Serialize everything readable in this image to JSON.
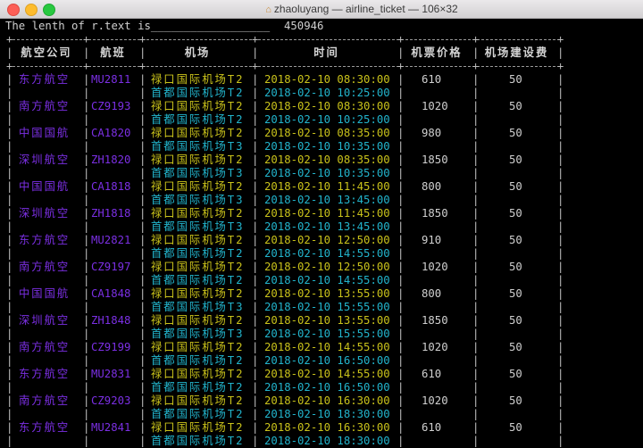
{
  "window": {
    "title": "zhaoluyang — airline_ticket — 106×32"
  },
  "colors": {
    "airline": "#7b2fe3",
    "departure": "#c9c21b",
    "arrival": "#22b4cc",
    "text": "#cfcfcf"
  },
  "output": {
    "length_label": "The lenth of r.text is__________________",
    "length_value": "450946"
  },
  "table": {
    "headers": [
      "航空公司",
      "航班",
      "机场",
      "时间",
      "机票价格",
      "机场建设费"
    ],
    "rows": [
      {
        "airline": "东方航空",
        "flight": "MU2811",
        "dep_airport": "禄口国际机场T2",
        "dep_time": "2018-02-10 08:30:00",
        "arr_airport": "首都国际机场T2",
        "arr_time": "2018-02-10 10:25:00",
        "price": "610",
        "fee": "50"
      },
      {
        "airline": "南方航空",
        "flight": "CZ9193",
        "dep_airport": "禄口国际机场T2",
        "dep_time": "2018-02-10 08:30:00",
        "arr_airport": "首都国际机场T2",
        "arr_time": "2018-02-10 10:25:00",
        "price": "1020",
        "fee": "50"
      },
      {
        "airline": "中国国航",
        "flight": "CA1820",
        "dep_airport": "禄口国际机场T2",
        "dep_time": "2018-02-10 08:35:00",
        "arr_airport": "首都国际机场T3",
        "arr_time": "2018-02-10 10:35:00",
        "price": "980",
        "fee": "50"
      },
      {
        "airline": "深圳航空",
        "flight": "ZH1820",
        "dep_airport": "禄口国际机场T2",
        "dep_time": "2018-02-10 08:35:00",
        "arr_airport": "首都国际机场T3",
        "arr_time": "2018-02-10 10:35:00",
        "price": "1850",
        "fee": "50"
      },
      {
        "airline": "中国国航",
        "flight": "CA1818",
        "dep_airport": "禄口国际机场T2",
        "dep_time": "2018-02-10 11:45:00",
        "arr_airport": "首都国际机场T3",
        "arr_time": "2018-02-10 13:45:00",
        "price": "800",
        "fee": "50"
      },
      {
        "airline": "深圳航空",
        "flight": "ZH1818",
        "dep_airport": "禄口国际机场T2",
        "dep_time": "2018-02-10 11:45:00",
        "arr_airport": "首都国际机场T3",
        "arr_time": "2018-02-10 13:45:00",
        "price": "1850",
        "fee": "50"
      },
      {
        "airline": "东方航空",
        "flight": "MU2821",
        "dep_airport": "禄口国际机场T2",
        "dep_time": "2018-02-10 12:50:00",
        "arr_airport": "首都国际机场T2",
        "arr_time": "2018-02-10 14:55:00",
        "price": "910",
        "fee": "50"
      },
      {
        "airline": "南方航空",
        "flight": "CZ9197",
        "dep_airport": "禄口国际机场T2",
        "dep_time": "2018-02-10 12:50:00",
        "arr_airport": "首都国际机场T2",
        "arr_time": "2018-02-10 14:55:00",
        "price": "1020",
        "fee": "50"
      },
      {
        "airline": "中国国航",
        "flight": "CA1848",
        "dep_airport": "禄口国际机场T2",
        "dep_time": "2018-02-10 13:55:00",
        "arr_airport": "首都国际机场T3",
        "arr_time": "2018-02-10 15:55:00",
        "price": "800",
        "fee": "50"
      },
      {
        "airline": "深圳航空",
        "flight": "ZH1848",
        "dep_airport": "禄口国际机场T2",
        "dep_time": "2018-02-10 13:55:00",
        "arr_airport": "首都国际机场T3",
        "arr_time": "2018-02-10 15:55:00",
        "price": "1850",
        "fee": "50"
      },
      {
        "airline": "南方航空",
        "flight": "CZ9199",
        "dep_airport": "禄口国际机场T2",
        "dep_time": "2018-02-10 14:55:00",
        "arr_airport": "首都国际机场T2",
        "arr_time": "2018-02-10 16:50:00",
        "price": "1020",
        "fee": "50"
      },
      {
        "airline": "东方航空",
        "flight": "MU2831",
        "dep_airport": "禄口国际机场T2",
        "dep_time": "2018-02-10 14:55:00",
        "arr_airport": "首都国际机场T2",
        "arr_time": "2018-02-10 16:50:00",
        "price": "610",
        "fee": "50"
      },
      {
        "airline": "南方航空",
        "flight": "CZ9203",
        "dep_airport": "禄口国际机场T2",
        "dep_time": "2018-02-10 16:30:00",
        "arr_airport": "首都国际机场T2",
        "arr_time": "2018-02-10 18:30:00",
        "price": "1020",
        "fee": "50"
      },
      {
        "airline": "东方航空",
        "flight": "MU2841",
        "dep_airport": "禄口国际机场T2",
        "dep_time": "2018-02-10 16:30:00",
        "arr_airport": "首都国际机场T2",
        "arr_time": "2018-02-10 18:30:00",
        "price": "610",
        "fee": "50"
      }
    ]
  }
}
